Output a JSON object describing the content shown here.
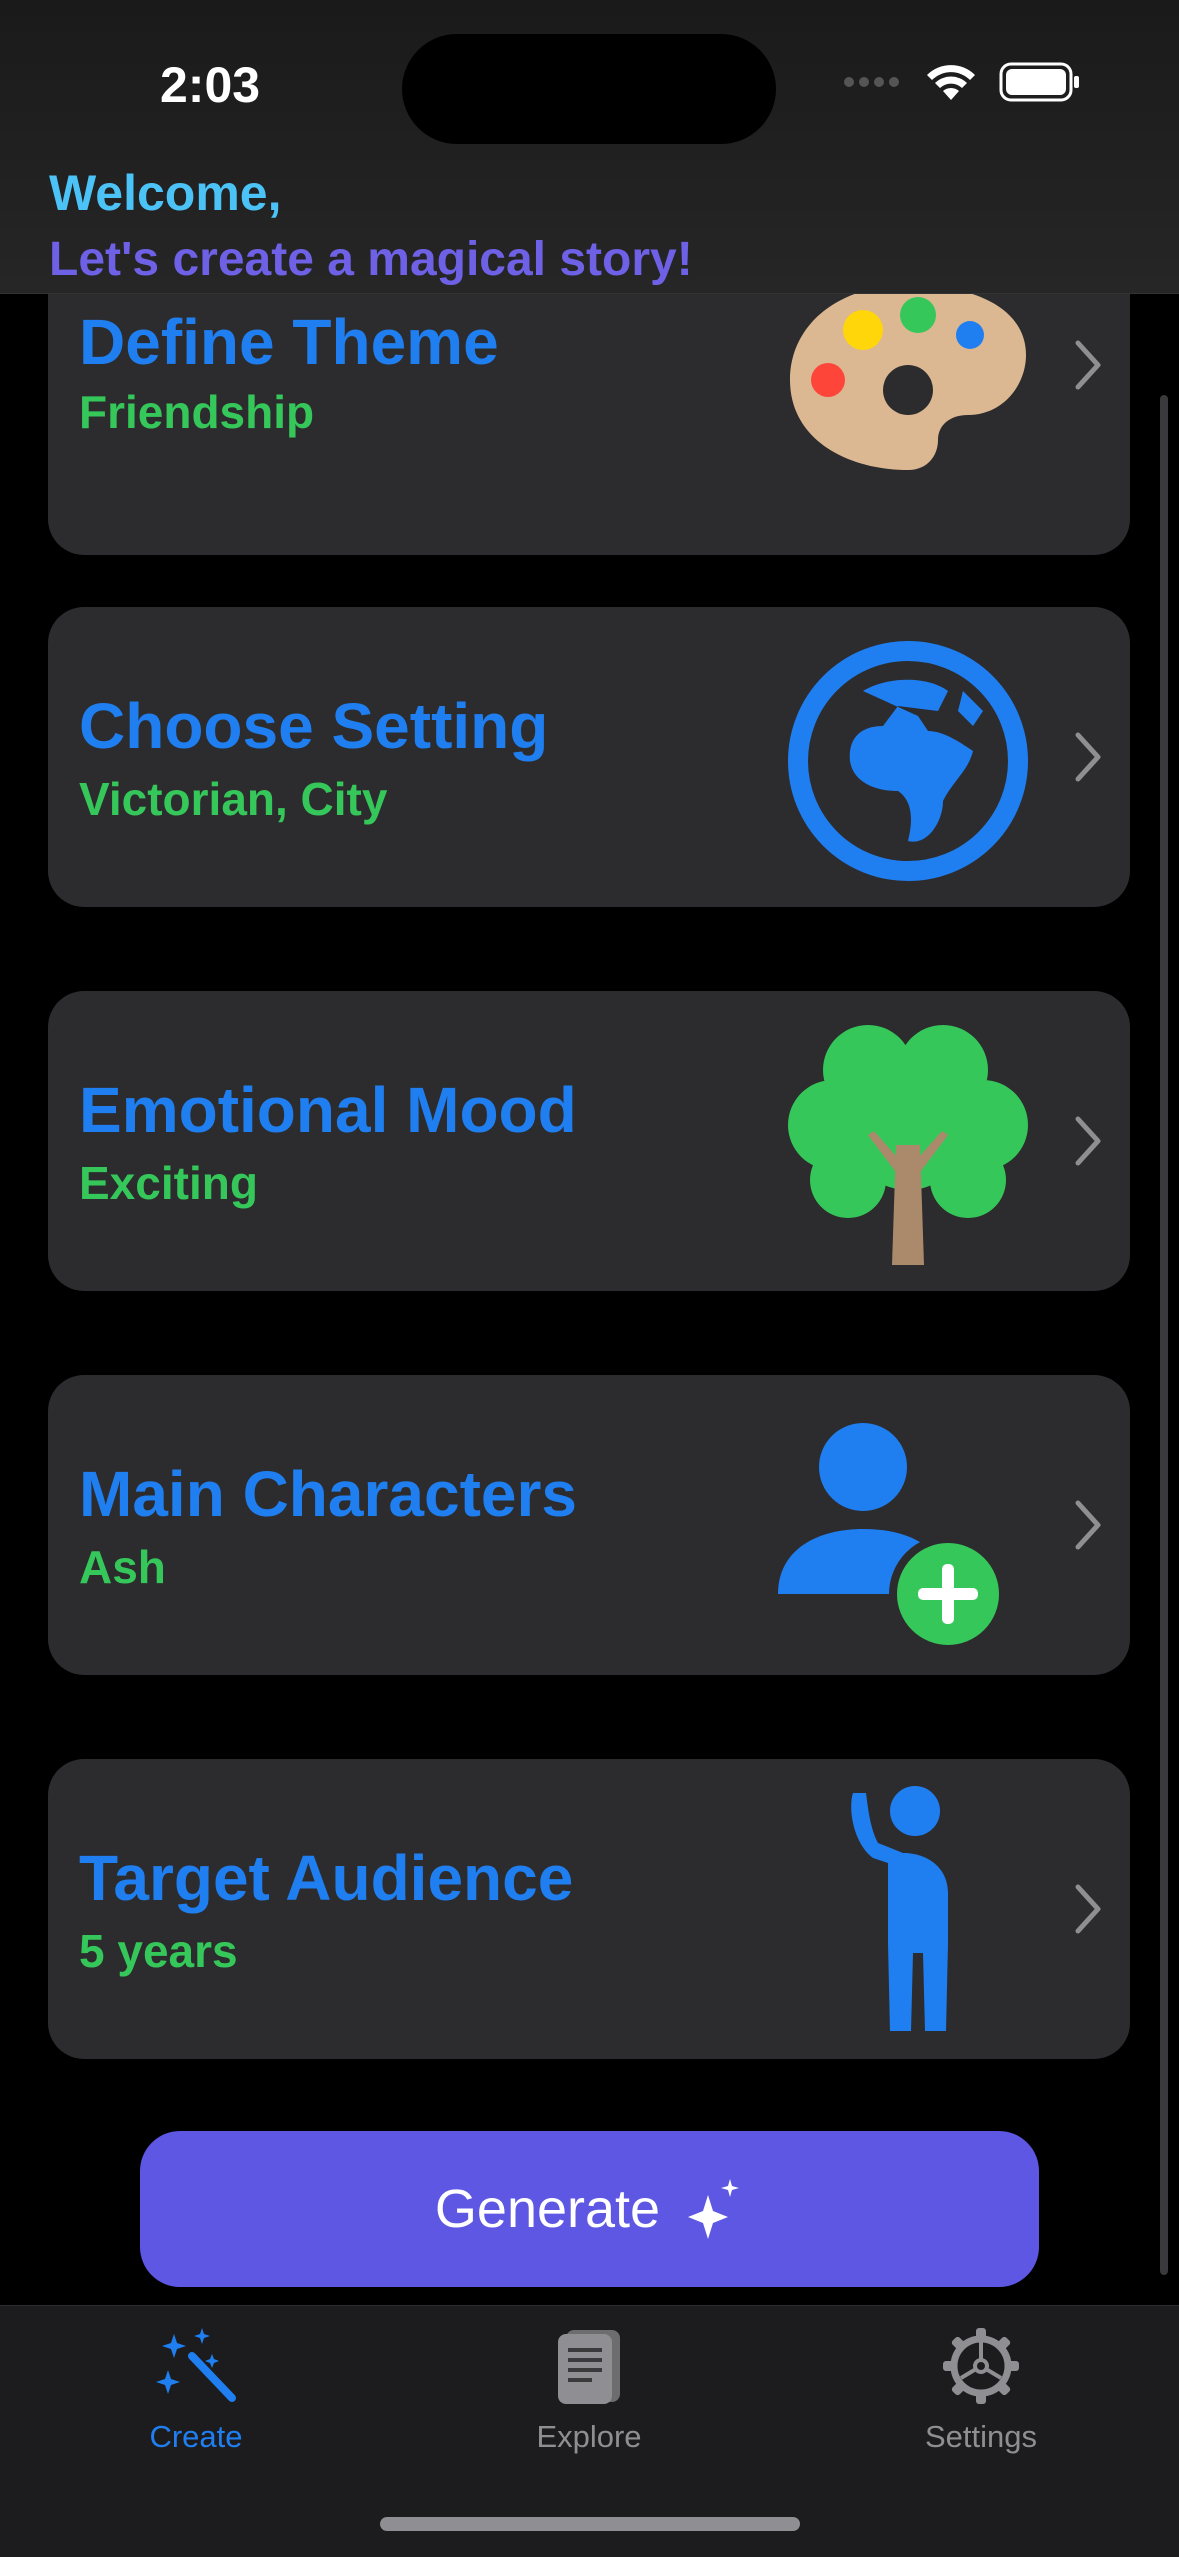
{
  "status_bar": {
    "time": "2:03"
  },
  "header": {
    "welcome": "Welcome,",
    "tagline": "Let's create a magical story!"
  },
  "cards": [
    {
      "title": "Define Theme",
      "value": "Friendship",
      "icon": "palette-icon"
    },
    {
      "title": "Choose Setting",
      "value": "Victorian, City",
      "icon": "globe-icon"
    },
    {
      "title": "Emotional Mood",
      "value": "Exciting",
      "icon": "tree-icon"
    },
    {
      "title": "Main Characters",
      "value": "Ash",
      "icon": "person-add-icon"
    },
    {
      "title": "Target Audience",
      "value": "5 years",
      "icon": "person-raised-hand-icon"
    }
  ],
  "generate_button": {
    "label": "Generate",
    "icon": "sparkles-icon"
  },
  "tabs": [
    {
      "label": "Create",
      "icon": "magic-wand-icon",
      "active": true
    },
    {
      "label": "Explore",
      "icon": "book-icon",
      "active": false
    },
    {
      "label": "Settings",
      "icon": "gear-icon",
      "active": false
    }
  ],
  "colors": {
    "accent_blue": "#1f7ff1",
    "value_green": "#35c759",
    "generate_purple": "#5d57e4",
    "welcome_cyan": "#4cc3f7",
    "tagline_purple": "#6e61e6"
  }
}
